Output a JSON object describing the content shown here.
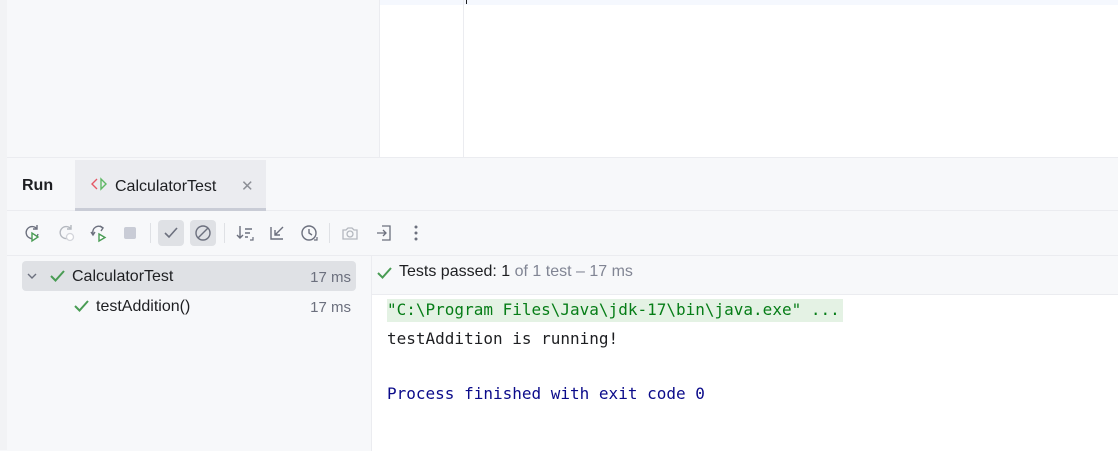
{
  "run_window": {
    "title": "Run",
    "tab": {
      "label": "CalculatorTest",
      "icon": "test-icon"
    }
  },
  "toolbar": {
    "buttons": [
      {
        "name": "rerun",
        "icon": "rerun-icon"
      },
      {
        "name": "rerun-failed",
        "icon": "rerun-failed-icon"
      },
      {
        "name": "toggle-auto-test",
        "icon": "auto-test-icon"
      },
      {
        "name": "stop",
        "icon": "stop-icon"
      },
      {
        "name": "show-passed",
        "icon": "check-icon",
        "active": true
      },
      {
        "name": "show-ignored",
        "icon": "ignored-icon",
        "active": true
      },
      {
        "name": "sort",
        "icon": "sort-icon"
      },
      {
        "name": "collapse",
        "icon": "collapse-icon"
      },
      {
        "name": "history",
        "icon": "history-icon"
      },
      {
        "name": "screenshot",
        "icon": "camera-icon"
      },
      {
        "name": "import",
        "icon": "import-icon"
      },
      {
        "name": "more",
        "icon": "more-vertical-icon"
      }
    ]
  },
  "tests": {
    "root": {
      "name": "CalculatorTest",
      "time": "17 ms",
      "status": "passed"
    },
    "children": [
      {
        "name": "testAddition()",
        "time": "17 ms",
        "status": "passed"
      }
    ]
  },
  "console": {
    "status_prefix": "Tests passed: ",
    "passed_count": "1",
    "status_suffix": " of 1 test – 17 ms",
    "command_line": "\"C:\\Program Files\\Java\\jdk-17\\bin\\java.exe\" ...",
    "output_line": "testAddition is running!",
    "exit_line": "Process finished with exit code 0"
  },
  "colors": {
    "pass_green": "#499c54",
    "command_bg": "#e4f2e4",
    "command_text": "#067d17",
    "exit_text": "#0b0b8a"
  }
}
